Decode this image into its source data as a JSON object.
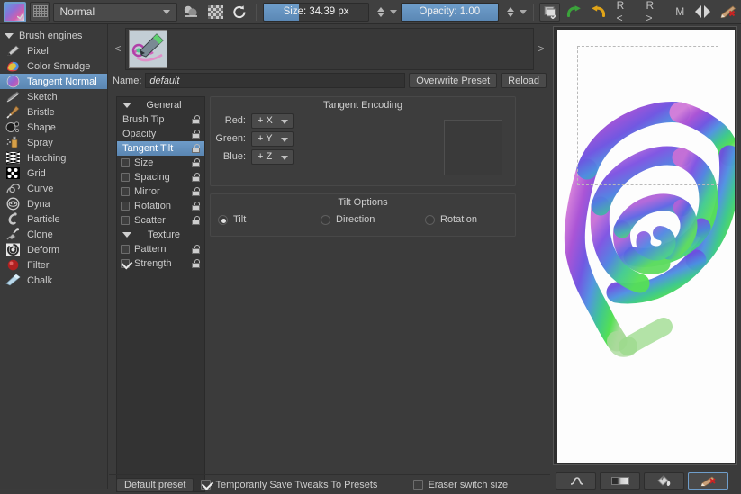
{
  "toolbar": {
    "color_selector_icon": "foreground-color-swatch",
    "pattern_icon": "pattern-chooser-icon",
    "blend_mode": "Normal",
    "gradient_icon": "fill-gradient-icon",
    "checker_icon": "pattern-fill-icon",
    "reset_icon": "reset-rotation-icon",
    "size_label": "Size:",
    "size_value": "34.39 px",
    "size_display": "Size:  34.39 px",
    "opacity_label": "Opacity:",
    "opacity_value": "1.00",
    "opacity_display": "Opacity:  1.00",
    "preset_icon": "brush-preset-chooser-icon",
    "redo_icon": "redo-icon",
    "undo_icon": "undo-icon",
    "rotate_left_label": "R <",
    "rotate_right_label": "R >",
    "mirror_label": "M",
    "mirror_icon": "mirror-horizontal-icon",
    "eraser_icon": "eraser-brush-icon",
    "accent_blue": "#6f9ecb"
  },
  "engines": {
    "header": "Brush engines",
    "items": [
      {
        "label": "Pixel",
        "icon": "pixel-brush-icon",
        "selected": false
      },
      {
        "label": "Color Smudge",
        "icon": "color-smudge-icon",
        "selected": false
      },
      {
        "label": "Tangent Normal",
        "icon": "tangent-normal-icon",
        "selected": true
      },
      {
        "label": "Sketch",
        "icon": "sketch-brush-icon",
        "selected": false
      },
      {
        "label": "Bristle",
        "icon": "bristle-brush-icon",
        "selected": false
      },
      {
        "label": "Shape",
        "icon": "shape-brush-icon",
        "selected": false
      },
      {
        "label": "Spray",
        "icon": "spray-brush-icon",
        "selected": false
      },
      {
        "label": "Hatching",
        "icon": "hatching-brush-icon",
        "selected": false
      },
      {
        "label": "Grid",
        "icon": "grid-brush-icon",
        "selected": false
      },
      {
        "label": "Curve",
        "icon": "curve-brush-icon",
        "selected": false
      },
      {
        "label": "Dyna",
        "icon": "dyna-brush-icon",
        "selected": false
      },
      {
        "label": "Particle",
        "icon": "particle-brush-icon",
        "selected": false
      },
      {
        "label": "Clone",
        "icon": "clone-brush-icon",
        "selected": false
      },
      {
        "label": "Deform",
        "icon": "deform-brush-icon",
        "selected": false
      },
      {
        "label": "Filter",
        "icon": "filter-brush-icon",
        "selected": false
      },
      {
        "label": "Chalk",
        "icon": "chalk-brush-icon",
        "selected": false
      }
    ]
  },
  "preset": {
    "prev_label": "<",
    "next_label": ">",
    "thumbnail_icon": "tangent-normal-preset-thumbnail",
    "name_label": "Name:",
    "name_value": "default",
    "overwrite_label": "Overwrite Preset",
    "reload_label": "Reload"
  },
  "options": {
    "groups": [
      {
        "name": "General",
        "rows": [
          {
            "label": "Brush Tip",
            "checkbox": false,
            "checked": false,
            "selected": false,
            "locked": true
          },
          {
            "label": "Opacity",
            "checkbox": false,
            "checked": false,
            "selected": false,
            "locked": true
          },
          {
            "label": "Tangent Tilt",
            "checkbox": false,
            "checked": false,
            "selected": true,
            "locked": true
          },
          {
            "label": "Size",
            "checkbox": true,
            "checked": false,
            "selected": false,
            "locked": true
          },
          {
            "label": "Spacing",
            "checkbox": true,
            "checked": false,
            "selected": false,
            "locked": true
          },
          {
            "label": "Mirror",
            "checkbox": true,
            "checked": false,
            "selected": false,
            "locked": true
          },
          {
            "label": "Rotation",
            "checkbox": true,
            "checked": false,
            "selected": false,
            "locked": true
          },
          {
            "label": "Scatter",
            "checkbox": true,
            "checked": false,
            "selected": false,
            "locked": true
          }
        ]
      },
      {
        "name": "Texture",
        "rows": [
          {
            "label": "Pattern",
            "checkbox": true,
            "checked": false,
            "selected": false,
            "locked": true
          },
          {
            "label": "Strength",
            "checkbox": true,
            "checked": true,
            "selected": false,
            "locked": true
          }
        ]
      }
    ]
  },
  "tangent_encoding": {
    "title": "Tangent Encoding",
    "channels": [
      {
        "label": "Red:",
        "value": "+ X"
      },
      {
        "label": "Green:",
        "value": "+ Y"
      },
      {
        "label": "Blue:",
        "value": "+ Z"
      }
    ],
    "preview_name": "tangent-preview"
  },
  "tilt_options": {
    "title": "Tilt Options",
    "items": [
      {
        "label": "Tilt",
        "selected": true
      },
      {
        "label": "Direction",
        "selected": false
      },
      {
        "label": "Rotation",
        "selected": false
      }
    ]
  },
  "bottom": {
    "default_preset_label": "Default preset",
    "temp_save_label": "Temporarily Save Tweaks To Presets",
    "temp_save_checked": true,
    "eraser_switch_label": "Eraser switch size",
    "eraser_switch_checked": false
  },
  "scratchpad": {
    "name": "scratchpad-canvas",
    "background": "#fdfdfd",
    "tools": [
      {
        "icon": "scribble-stroke-icon",
        "selected": false
      },
      {
        "icon": "gradient-fill-icon",
        "selected": false
      },
      {
        "icon": "paint-bucket-icon",
        "selected": false
      },
      {
        "icon": "eraser-clear-icon",
        "selected": true
      }
    ]
  }
}
